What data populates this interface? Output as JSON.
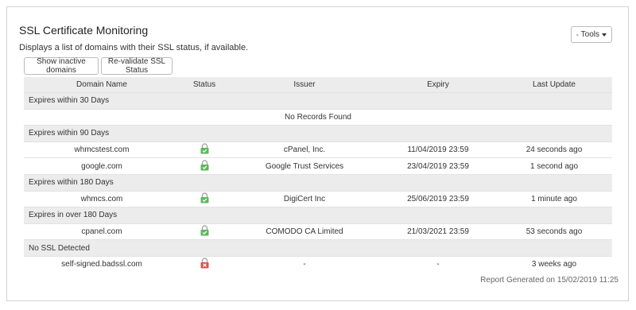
{
  "header": {
    "title": "SSL Certificate Monitoring",
    "description": "Displays a list of domains with their SSL status, if available.",
    "tools_label": "Tools",
    "show_inactive_label": "Show inactive domains",
    "revalidate_label": "Re-validate SSL Status"
  },
  "table": {
    "columns": [
      "Domain Name",
      "Status",
      "Issuer",
      "Expiry",
      "Last Update"
    ],
    "groups": [
      {
        "label": "Expires within 30 Days",
        "empty_text": "No Records Found",
        "rows": []
      },
      {
        "label": "Expires within 90 Days",
        "rows": [
          {
            "domain": "whmcstest.com",
            "status": "valid",
            "issuer": "cPanel, Inc.",
            "expiry": "11/04/2019 23:59",
            "last_update": "24 seconds ago"
          },
          {
            "domain": "google.com",
            "status": "valid",
            "issuer": "Google Trust Services",
            "expiry": "23/04/2019 23:59",
            "last_update": "1 second ago"
          }
        ]
      },
      {
        "label": "Expires within 180 Days",
        "rows": [
          {
            "domain": "whmcs.com",
            "status": "valid",
            "issuer": "DigiCert Inc",
            "expiry": "25/06/2019 23:59",
            "last_update": "1 minute ago"
          }
        ]
      },
      {
        "label": "Expires in over 180 Days",
        "rows": [
          {
            "domain": "cpanel.com",
            "status": "valid",
            "issuer": "COMODO CA Limited",
            "expiry": "21/03/2021 23:59",
            "last_update": "53 seconds ago"
          }
        ]
      },
      {
        "label": "No SSL Detected",
        "rows": [
          {
            "domain": "self-signed.badssl.com",
            "status": "invalid",
            "issuer": "-",
            "expiry": "-",
            "last_update": "3 weeks ago"
          }
        ]
      }
    ]
  },
  "footer": {
    "report_text": "Report Generated on 15/02/2019 11:25"
  },
  "colors": {
    "valid": "#5cb85c",
    "invalid": "#d9534f"
  },
  "icons": {
    "tools": "gear-icon",
    "valid": "lock-closed-icon",
    "invalid": "lock-error-icon"
  }
}
